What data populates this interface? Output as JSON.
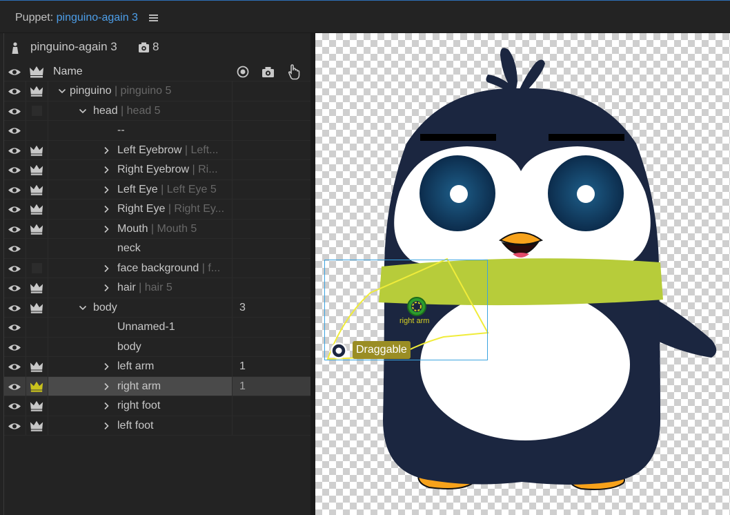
{
  "panel": {
    "title_prefix": "Puppet:",
    "puppet_name": "pinguino-again 3",
    "menu_icon": "hamburger-menu-icon"
  },
  "puppet": {
    "name": "pinguino-again 3",
    "icon": "person-icon",
    "clip_icon": "camera-gear-icon",
    "clip_count": "8"
  },
  "columns": {
    "name": "Name",
    "icons": [
      "eye-icon",
      "crown-icon",
      "target-icon",
      "camera-icon",
      "hand-icon"
    ]
  },
  "tree": [
    {
      "label": "pinguino",
      "alias": "| pinguino 5",
      "indent": 0,
      "chevron": "down",
      "crown": true,
      "count": ""
    },
    {
      "label": "head",
      "alias": "| head 5",
      "indent": 1,
      "chevron": "down",
      "crown": false,
      "dim": true,
      "count": ""
    },
    {
      "label": "--",
      "alias": "",
      "indent": 2,
      "chevron": "",
      "crown": false,
      "count": ""
    },
    {
      "label": "Left Eyebrow",
      "alias": "| Left...",
      "indent": 2,
      "chevron": "right",
      "crown": true,
      "count": ""
    },
    {
      "label": "Right Eyebrow",
      "alias": "| Ri...",
      "indent": 2,
      "chevron": "right",
      "crown": true,
      "count": ""
    },
    {
      "label": "Left Eye",
      "alias": "| Left Eye 5",
      "indent": 2,
      "chevron": "right",
      "crown": true,
      "count": ""
    },
    {
      "label": "Right Eye",
      "alias": "| Right Ey...",
      "indent": 2,
      "chevron": "right",
      "crown": true,
      "count": ""
    },
    {
      "label": "Mouth",
      "alias": "| Mouth 5",
      "indent": 2,
      "chevron": "right",
      "crown": true,
      "count": ""
    },
    {
      "label": "neck",
      "alias": "",
      "indent": 2,
      "chevron": "",
      "crown": false,
      "count": ""
    },
    {
      "label": "face background",
      "alias": "| f...",
      "indent": 2,
      "chevron": "right",
      "crown": false,
      "dim": true,
      "count": ""
    },
    {
      "label": "hair",
      "alias": "| hair 5",
      "indent": 2,
      "chevron": "right",
      "crown": true,
      "count": ""
    },
    {
      "label": "body",
      "alias": "",
      "indent": 1,
      "chevron": "down",
      "crown": true,
      "count": "3"
    },
    {
      "label": "Unnamed-1",
      "alias": "",
      "indent": 2,
      "chevron": "",
      "crown": false,
      "count": ""
    },
    {
      "label": "body",
      "alias": "",
      "indent": 2,
      "chevron": "",
      "crown": false,
      "count": ""
    },
    {
      "label": "left arm",
      "alias": "",
      "indent": 2,
      "chevron": "right",
      "crown": true,
      "count": "1"
    },
    {
      "label": "right arm",
      "alias": "",
      "indent": 2,
      "chevron": "right",
      "crown": true,
      "selected": true,
      "count": "1"
    },
    {
      "label": "right foot",
      "alias": "",
      "indent": 2,
      "chevron": "right",
      "crown": true,
      "count": ""
    },
    {
      "label": "left foot",
      "alias": "",
      "indent": 2,
      "chevron": "right",
      "crown": true,
      "count": ""
    }
  ],
  "canvas": {
    "tag_label": "Draggable",
    "handle_label": "right arm",
    "colors": {
      "accent": "#4d9fea",
      "selection": "#3aa3e0",
      "tag_bg": "#9a8d24",
      "handle": "#d8d322",
      "crown_selected": "#c9c21d",
      "penguin_body": "#1b2640",
      "scarf": "#b7cc3a",
      "beak": "#f7a21b"
    }
  }
}
